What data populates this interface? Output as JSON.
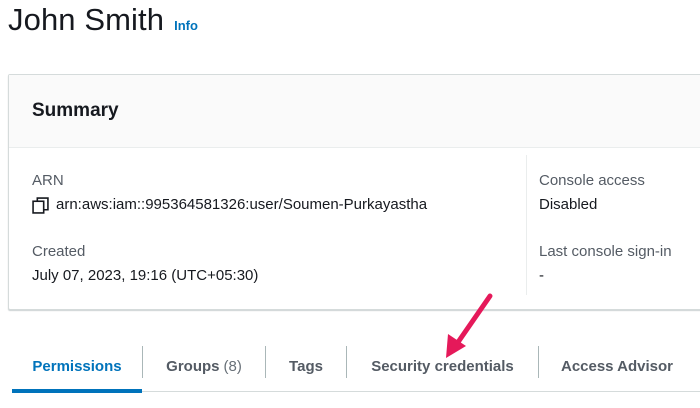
{
  "header": {
    "title": "John Smith",
    "info_label": "Info"
  },
  "summary": {
    "title": "Summary",
    "arn_label": "ARN",
    "arn_value": "arn:aws:iam::995364581326:user/Soumen-Purkayastha",
    "created_label": "Created",
    "created_value": "July 07, 2023, 19:16 (UTC+05:30)",
    "console_access_label": "Console access",
    "console_access_value": "Disabled",
    "last_signin_label": "Last console sign-in",
    "last_signin_value": "-"
  },
  "tabs": [
    {
      "label": "Permissions",
      "active": true
    },
    {
      "label": "Groups",
      "count": "(8)"
    },
    {
      "label": "Tags"
    },
    {
      "label": "Security credentials"
    },
    {
      "label": "Access Advisor"
    }
  ],
  "icons": {
    "copy": "copy-icon",
    "annotation": "arrow-annotation-icon"
  },
  "colors": {
    "link": "#0073bb",
    "arrow": "#e5195a"
  }
}
